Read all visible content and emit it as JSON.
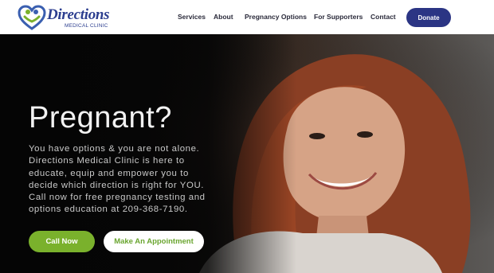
{
  "brand": {
    "name": "Directions",
    "subtitle": "MEDICAL CLINIC",
    "colors": {
      "navy": "#2b3584",
      "green": "#7ab12c",
      "heart_blue": "#3a5fb0"
    },
    "logo_icon": "heart-people-icon"
  },
  "nav": {
    "items": [
      {
        "label": "Services"
      },
      {
        "label": "About"
      },
      {
        "label": "Pregnancy Options"
      },
      {
        "label": "For Supporters"
      },
      {
        "label": "Contact"
      }
    ],
    "donate_label": "Donate"
  },
  "hero": {
    "title": "Pregnant?",
    "body": "You have options & you are not alone. Directions Medical Clinic is here to educate, equip and empower you to decide which direction is right for YOU. Call now for free pregnancy testing and options education at 209-368-7190.",
    "primary_cta": "Call Now",
    "secondary_cta": "Make An Appointment"
  }
}
